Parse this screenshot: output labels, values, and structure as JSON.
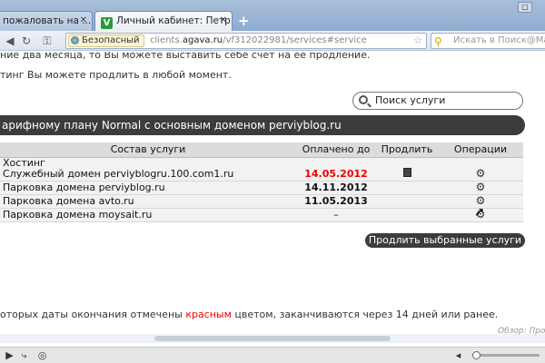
{
  "browser": {
    "tabs": [
      {
        "label": "пожаловать на ..."
      },
      {
        "label": "Личный кабинет: Петр..."
      }
    ],
    "new_tab_label": "+",
    "identity_label": "Безопасный",
    "url": {
      "prefix": "clients.",
      "domain": "agava.ru",
      "path": "/vf312022981/services#service"
    },
    "search_placeholder": "Искать в Поиск@Mail.ru"
  },
  "page": {
    "line1": "ние два месяца, то Вы можете выставить себе счет на ее продление.",
    "line2": "тинг Вы можете продлить в любой момент.",
    "search_button": "Поиск услуги",
    "plan_header": "арифному плану Normal с основным доменом perviyblog.ru",
    "table": {
      "headers": [
        "Состав услуги",
        "Оплачено до",
        "Продлить",
        "Операции"
      ],
      "rows": [
        {
          "name": "Хостинг",
          "subname": "Служебный домен perviyblogru.100.com1.ru",
          "date": "14.05.2012",
          "date_red": true,
          "extend": true
        },
        {
          "name": "Парковка домена perviyblog.ru",
          "subname": "",
          "date": "14.11.2012",
          "date_red": false,
          "extend": false
        },
        {
          "name": "Парковка домена avto.ru",
          "subname": "",
          "date": "11.05.2013",
          "date_red": false,
          "extend": false
        },
        {
          "name": "Парковка домена moysait.ru",
          "subname": "",
          "date": "–",
          "date_red": false,
          "extend": false
        }
      ]
    },
    "extend_button": "Продлить выбранные услуги",
    "note_before": "оторых даты окончания отмечены ",
    "note_red": "красным",
    "note_after": " цветом, заканчиваются через 14 дней или ранее."
  },
  "watermark": "Обзор: Прол",
  "colors": {
    "accent_dark": "#3c3c3c",
    "red": "#e00000"
  }
}
